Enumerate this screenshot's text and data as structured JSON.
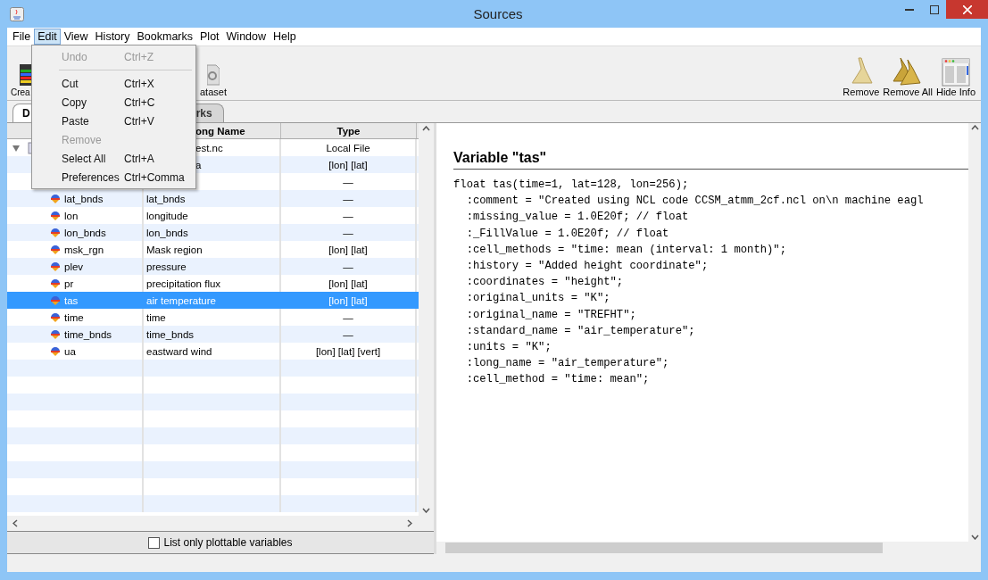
{
  "window": {
    "title": "Sources"
  },
  "menu_bar": [
    {
      "label": "File",
      "selected": false
    },
    {
      "label": "Edit",
      "selected": true
    },
    {
      "label": "View",
      "selected": false
    },
    {
      "label": "History",
      "selected": false
    },
    {
      "label": "Bookmarks",
      "selected": false
    },
    {
      "label": "Plot",
      "selected": false
    },
    {
      "label": "Window",
      "selected": false
    },
    {
      "label": "Help",
      "selected": false
    }
  ],
  "edit_menu": [
    {
      "kind": "item",
      "label": "Undo",
      "shortcut": "Ctrl+Z",
      "disabled": true
    },
    {
      "kind": "separator"
    },
    {
      "kind": "item",
      "label": "Cut",
      "shortcut": "Ctrl+X",
      "disabled": false
    },
    {
      "kind": "item",
      "label": "Copy",
      "shortcut": "Ctrl+C",
      "disabled": false
    },
    {
      "kind": "item",
      "label": "Paste",
      "shortcut": "Ctrl+V",
      "disabled": false
    },
    {
      "kind": "item",
      "label": "Remove",
      "disabled": true
    },
    {
      "kind": "item",
      "label": "Select All",
      "shortcut": "Ctrl+A",
      "disabled": false
    },
    {
      "kind": "item",
      "label": "Preferences",
      "shortcut": "Ctrl+Comma",
      "disabled": false
    }
  ],
  "toolbar": {
    "left": [
      {
        "label": "Crea"
      },
      {
        "label": "ataset"
      }
    ],
    "right": [
      {
        "kind": "broom",
        "label": "Remove"
      },
      {
        "kind": "brooms",
        "label": "Remove All"
      },
      {
        "kind": "info",
        "label": "Hide Info"
      }
    ]
  },
  "tabs": [
    {
      "label": "D",
      "selected": true
    },
    {
      "label": "rks",
      "selected": false
    }
  ],
  "table": {
    "columns": [
      "ong Name",
      "Type"
    ],
    "rows": [
      {
        "kind": "file",
        "expanded": true,
        "long_name": "est.nc",
        "type": "Local File",
        "selected": false
      },
      {
        "kind": "variable",
        "long_name": "a",
        "type": "[lon] [lat]",
        "selected": false
      },
      {
        "kind": "variable",
        "type": "—",
        "selected": false
      },
      {
        "kind": "variable",
        "name": "lat_bnds",
        "long_name": "lat_bnds",
        "type": "—",
        "selected": false
      },
      {
        "kind": "variable",
        "name": "lon",
        "long_name": "longitude",
        "type": "—",
        "selected": false
      },
      {
        "kind": "variable",
        "name": "lon_bnds",
        "long_name": "lon_bnds",
        "type": "—",
        "selected": false
      },
      {
        "kind": "variable",
        "name": "msk_rgn",
        "long_name": "Mask region",
        "type": "[lon] [lat]",
        "selected": false
      },
      {
        "kind": "variable",
        "name": "plev",
        "long_name": "pressure",
        "type": "—",
        "selected": false
      },
      {
        "kind": "variable",
        "name": "pr",
        "long_name": "precipitation flux",
        "type": "[lon] [lat]",
        "selected": false
      },
      {
        "kind": "variable",
        "name": "tas",
        "long_name": "air temperature",
        "type": "[lon] [lat]",
        "selected": true
      },
      {
        "kind": "variable",
        "name": "time",
        "long_name": "time",
        "type": "—",
        "selected": false
      },
      {
        "kind": "variable",
        "name": "time_bnds",
        "long_name": "time_bnds",
        "type": "—",
        "selected": false
      },
      {
        "kind": "variable",
        "name": "ua",
        "long_name": "eastward wind",
        "type": "[lon] [lat] [vert]",
        "selected": false
      }
    ]
  },
  "plottable_only": {
    "label": "List only plottable variables",
    "checked": false
  },
  "info": {
    "title": "Variable \"tas\"",
    "lines": [
      "float tas(time=1, lat=128, lon=256);",
      "  :comment = \"Created using NCL code CCSM_atmm_2cf.ncl on\\n machine eagl",
      "  :missing_value = 1.0E20f; // float",
      "  :_FillValue = 1.0E20f; // float",
      "  :cell_methods = \"time: mean (interval: 1 month)\";",
      "  :history = \"Added height coordinate\";",
      "  :coordinates = \"height\";",
      "  :original_units = \"K\";",
      "  :original_name = \"TREFHT\";",
      "  :standard_name = \"air_temperature\";",
      "  :units = \"K\";",
      "  :long_name = \"air_temperature\";",
      "  :cell_method = \"time: mean\";"
    ]
  }
}
